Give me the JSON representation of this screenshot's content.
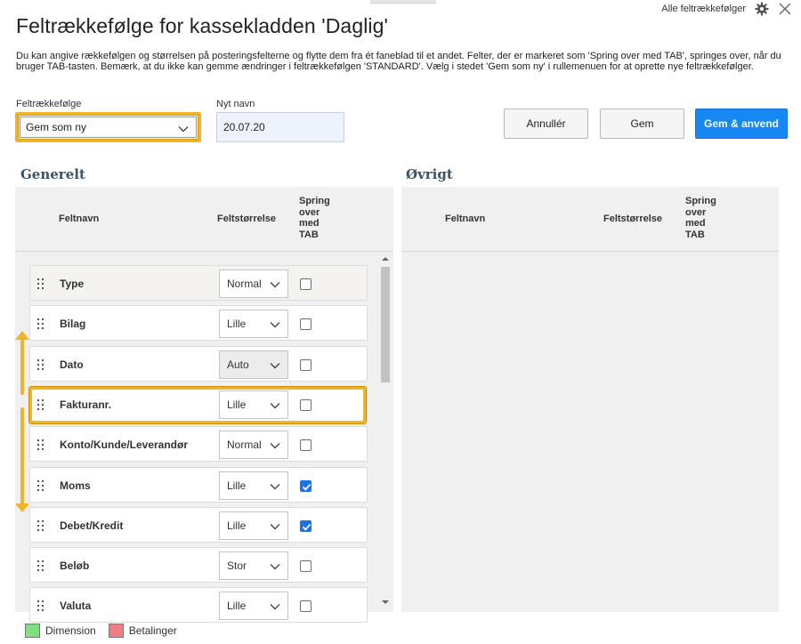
{
  "window": {
    "title": "Feltrækkefølge for kassekladden 'Daglig'",
    "all_sequences_link": "Alle feltrækkefølger",
    "settings_icon": "gear-icon",
    "close_icon": "close-icon"
  },
  "description": "Du kan angive rækkefølgen og størrelsen på posteringsfelterne og flytte dem fra ét faneblad til et andet. Felter, der er markeret som 'Spring over med TAB', springes over, når du bruger TAB-tasten. Bemærk, at du ikke kan gemme ændringer i feltrækkefølgen 'STANDARD'. Vælg i stedet 'Gem som ny' i rullemenuen for at oprette nye feltrækkefølger.",
  "form": {
    "sequence_label": "Feltrækkefølge",
    "sequence_value": "Gem som ny",
    "name_label": "Nyt navn",
    "name_value": "20.07.20"
  },
  "buttons": {
    "cancel": "Annullér",
    "save": "Gem",
    "save_apply": "Gem & anvend"
  },
  "sections": {
    "general": "Generelt",
    "other": "Øvrigt"
  },
  "columns": {
    "field_name": "Feltnavn",
    "field_size": "Feltstørrelse",
    "skip_tab": [
      "Spring",
      "over",
      "med",
      "TAB"
    ]
  },
  "rows": [
    {
      "name": "Type",
      "size": "Normal",
      "skip": false
    },
    {
      "name": "Bilag",
      "size": "Lille",
      "skip": false
    },
    {
      "name": "Dato",
      "size": "Auto",
      "skip": false
    },
    {
      "name": "Fakturanr.",
      "size": "Lille",
      "skip": false
    },
    {
      "name": "Konto/Kunde/Leverandør",
      "size": "Normal",
      "skip": false
    },
    {
      "name": "Moms",
      "size": "Lille",
      "skip": true
    },
    {
      "name": "Debet/Kredit",
      "size": "Lille",
      "skip": true
    },
    {
      "name": "Beløb",
      "size": "Stor",
      "skip": false
    },
    {
      "name": "Valuta",
      "size": "Lille",
      "skip": false
    }
  ],
  "legend": [
    {
      "label": "Dimension",
      "color": "#7ee07e"
    },
    {
      "label": "Betalinger",
      "color": "#f07c84"
    }
  ],
  "colors": {
    "highlight": "#f0b429",
    "primary_button": "#1687f3",
    "checkbox_checked": "#1a73e8"
  }
}
